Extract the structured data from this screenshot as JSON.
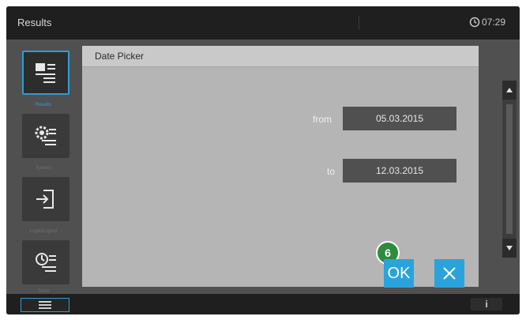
{
  "topbar": {
    "title": "Results",
    "clock": "07:29"
  },
  "sidebar": {
    "items": [
      {
        "label": "Results",
        "icon": "results-list-icon",
        "active": true
      },
      {
        "label": "System",
        "icon": "system-gear-icon",
        "active": false
      },
      {
        "label": "Login/Logout",
        "icon": "login-logout-icon",
        "active": false
      },
      {
        "label": "Timer",
        "icon": "timer-icon",
        "active": false
      }
    ]
  },
  "dialog": {
    "title": "Date Picker",
    "from_label": "from",
    "from_value": "05.03.2015",
    "to_label": "to",
    "to_value": "12.03.2015",
    "ok_label": "OK",
    "cancel_icon": "close-icon",
    "callout_number": "6"
  },
  "bottombar": {
    "menu_icon": "hamburger-icon",
    "info_label": "i"
  },
  "colors": {
    "accent": "#2aa3dc",
    "callout": "#2f8b3e",
    "topbar": "#1f1f1f",
    "dialog_bg": "#b5b5b5",
    "field_bg": "#505050"
  }
}
